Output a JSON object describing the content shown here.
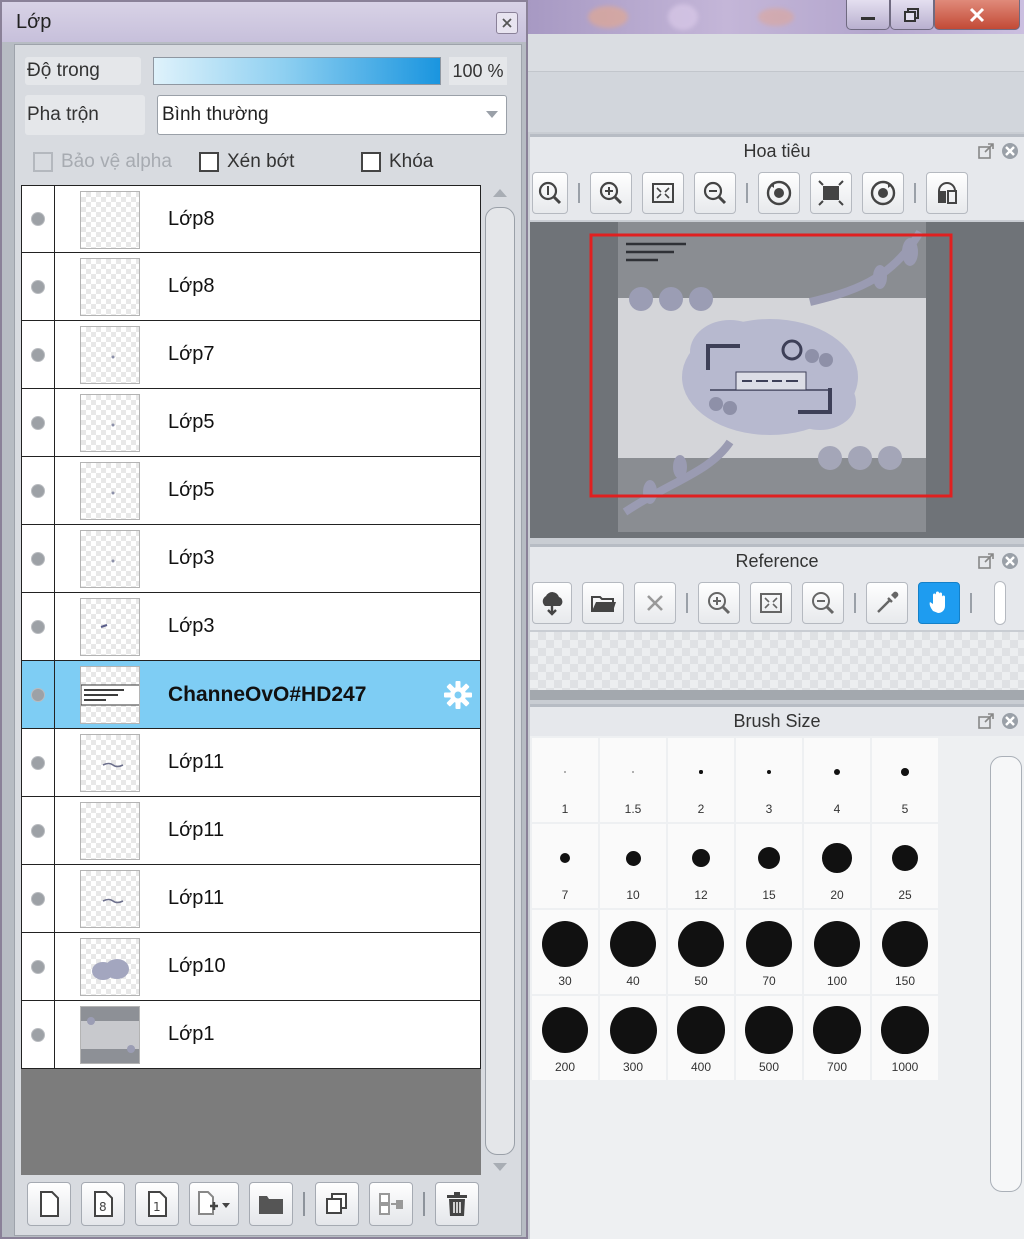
{
  "layer_panel": {
    "title": "Lớp",
    "opacity_label": "Độ trong",
    "opacity_value": "100 %",
    "opacity_level": 1.0,
    "blend_label": "Pha trộn",
    "blend_value": "Bình thường",
    "checkboxes": {
      "protect_alpha": "Bảo vệ alpha",
      "clipping": "Xén bớt",
      "lock": "Khóa"
    },
    "layers": [
      {
        "name": "Lớp8",
        "thumb": "empty"
      },
      {
        "name": "Lớp8",
        "thumb": "empty"
      },
      {
        "name": "Lớp7",
        "thumb": "dot"
      },
      {
        "name": "Lớp5",
        "thumb": "dot"
      },
      {
        "name": "Lớp5",
        "thumb": "dot"
      },
      {
        "name": "Lớp3",
        "thumb": "dot"
      },
      {
        "name": "Lớp3",
        "thumb": "mark"
      },
      {
        "name": "ChanneOvO#HD247",
        "thumb": "text",
        "selected": true
      },
      {
        "name": "Lớp11",
        "thumb": "scribble"
      },
      {
        "name": "Lớp11",
        "thumb": "empty"
      },
      {
        "name": "Lớp11",
        "thumb": "scribble"
      },
      {
        "name": "Lớp10",
        "thumb": "blob"
      },
      {
        "name": "Lớp1",
        "thumb": "photo"
      }
    ]
  },
  "navigator": {
    "title": "Hoa tiêu"
  },
  "reference": {
    "title": "Reference"
  },
  "brush_size": {
    "title": "Brush Size",
    "sizes": [
      "1",
      "1.5",
      "2",
      "3",
      "4",
      "5",
      "7",
      "10",
      "12",
      "15",
      "20",
      "25",
      "30",
      "40",
      "50",
      "70",
      "100",
      "150",
      "200",
      "300",
      "400",
      "500",
      "700",
      "1000"
    ]
  },
  "colors": {
    "accent": "#1e9cf0",
    "selected_layer": "#7ecdf4"
  }
}
